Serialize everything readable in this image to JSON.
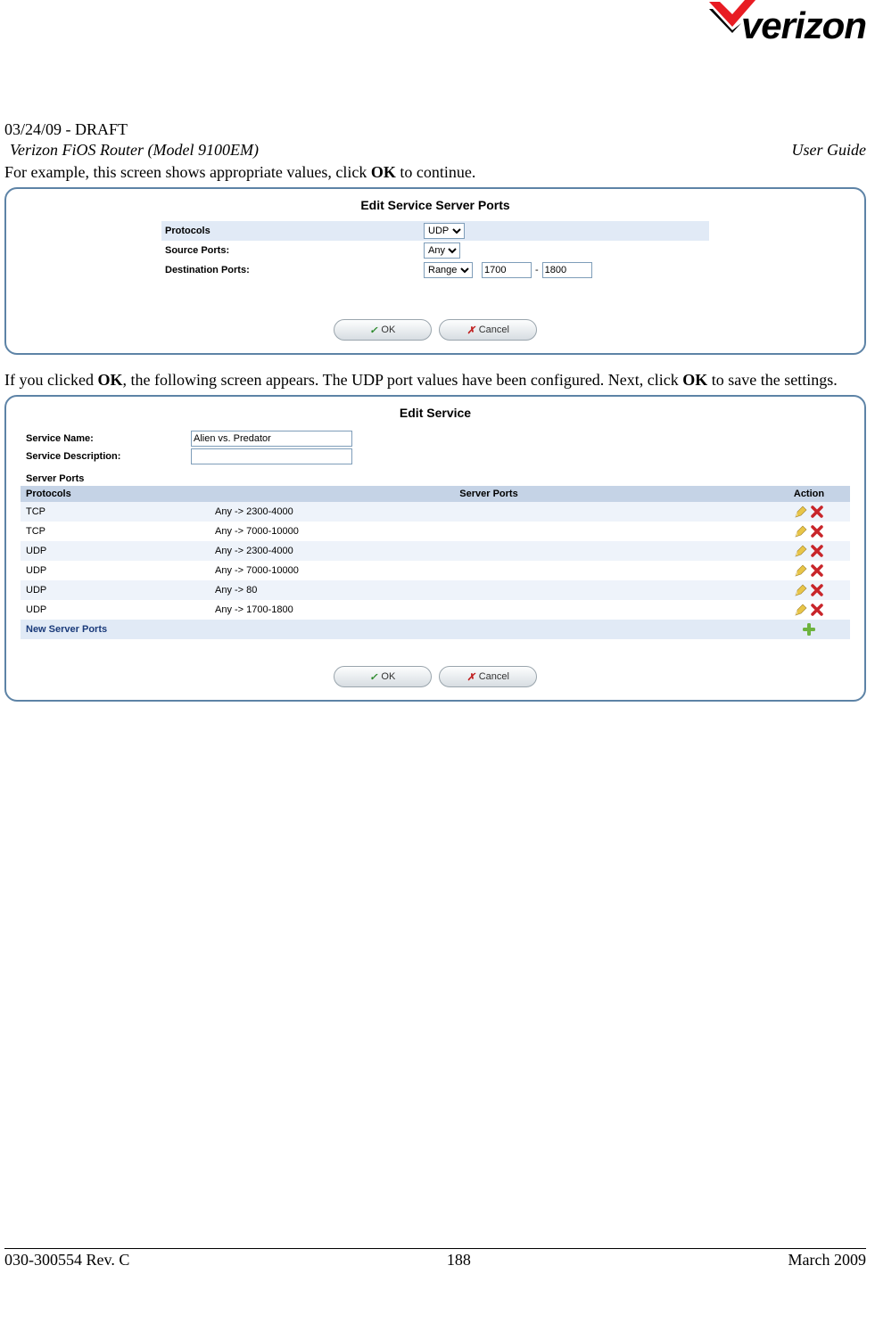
{
  "header": {
    "brand": "verizon",
    "draft": "03/24/09 - DRAFT",
    "product": "Verizon FiOS Router (Model 9100EM)",
    "doc_type": "User Guide"
  },
  "body": {
    "para1_pre": "For example, this screen shows appropriate values, click ",
    "para1_bold": "OK",
    "para1_post": " to continue.",
    "para2_pre": "If you clicked ",
    "para2_b1": "OK",
    "para2_mid": ", the following screen appears. The UDP port values have been configured. Next, click ",
    "para2_b2": "OK",
    "para2_post": " to save the settings."
  },
  "screenshot1": {
    "title": "Edit Service Server Ports",
    "protocols_label": "Protocols",
    "protocols_value": "UDP",
    "src_label": "Source Ports:",
    "src_value": "Any",
    "dst_label": "Destination Ports:",
    "dst_mode": "Range",
    "dst_from": "1700",
    "dst_to": "1800",
    "ok": "OK",
    "cancel": "Cancel"
  },
  "screenshot2": {
    "title": "Edit Service",
    "svc_name_label": "Service Name:",
    "svc_name_value": "Alien vs. Predator",
    "svc_desc_label": "Service Description:",
    "svc_desc_value": "",
    "server_ports_hdr": "Server Ports",
    "cols": {
      "c1": "Protocols",
      "c2": "Server Ports",
      "c3": "Action"
    },
    "rows": [
      {
        "proto": "TCP",
        "ports": "Any -> 2300-4000"
      },
      {
        "proto": "TCP",
        "ports": "Any -> 7000-10000"
      },
      {
        "proto": "UDP",
        "ports": "Any -> 2300-4000"
      },
      {
        "proto": "UDP",
        "ports": "Any -> 7000-10000"
      },
      {
        "proto": "UDP",
        "ports": "Any -> 80"
      },
      {
        "proto": "UDP",
        "ports": "Any -> 1700-1800"
      }
    ],
    "new_row": "New Server Ports",
    "ok": "OK",
    "cancel": "Cancel"
  },
  "footer": {
    "left": "030-300554 Rev. C",
    "center": "188",
    "right": "March 2009"
  }
}
